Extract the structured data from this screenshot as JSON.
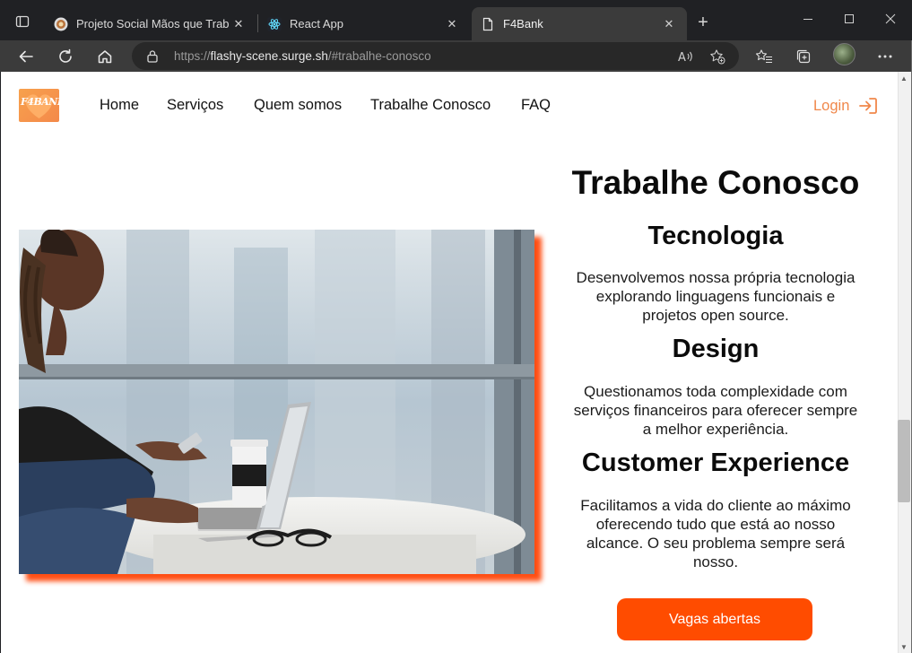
{
  "browser": {
    "tabs": [
      {
        "title": "Projeto Social Mãos que Trabalha",
        "icon": "social-project-favicon"
      },
      {
        "title": "React App",
        "icon": "react-favicon"
      },
      {
        "title": "F4Bank",
        "icon": "page-favicon"
      }
    ],
    "url_scheme": "https://",
    "url_host": "flashy-scene.surge.sh",
    "url_path": "/#trabalhe-conosco"
  },
  "site": {
    "logo_text": "F4BANK",
    "nav": [
      "Home",
      "Serviços",
      "Quem somos",
      "Trabalhe Conosco",
      "FAQ"
    ],
    "login_label": "Login",
    "accent_color": "#ff4c00"
  },
  "content": {
    "heading": "Trabalhe Conosco",
    "sections": [
      {
        "title": "Tecnologia",
        "lines": [
          "Desenvolvemos nossa própria tecnologia",
          "explorando linguagens funcionais e",
          "projetos open source."
        ]
      },
      {
        "title": "Design",
        "lines": [
          "Questionamos toda complexidade com",
          "serviços financeiros para oferecer sempre",
          "a melhor experiência."
        ]
      },
      {
        "title": "Customer Experience",
        "lines": [
          "Facilitamos a vida do cliente ao máximo",
          "oferecendo tudo que está ao nosso",
          "alcance. O seu problema sempre será",
          "nosso."
        ]
      }
    ],
    "cta_label": "Vagas abertas"
  }
}
